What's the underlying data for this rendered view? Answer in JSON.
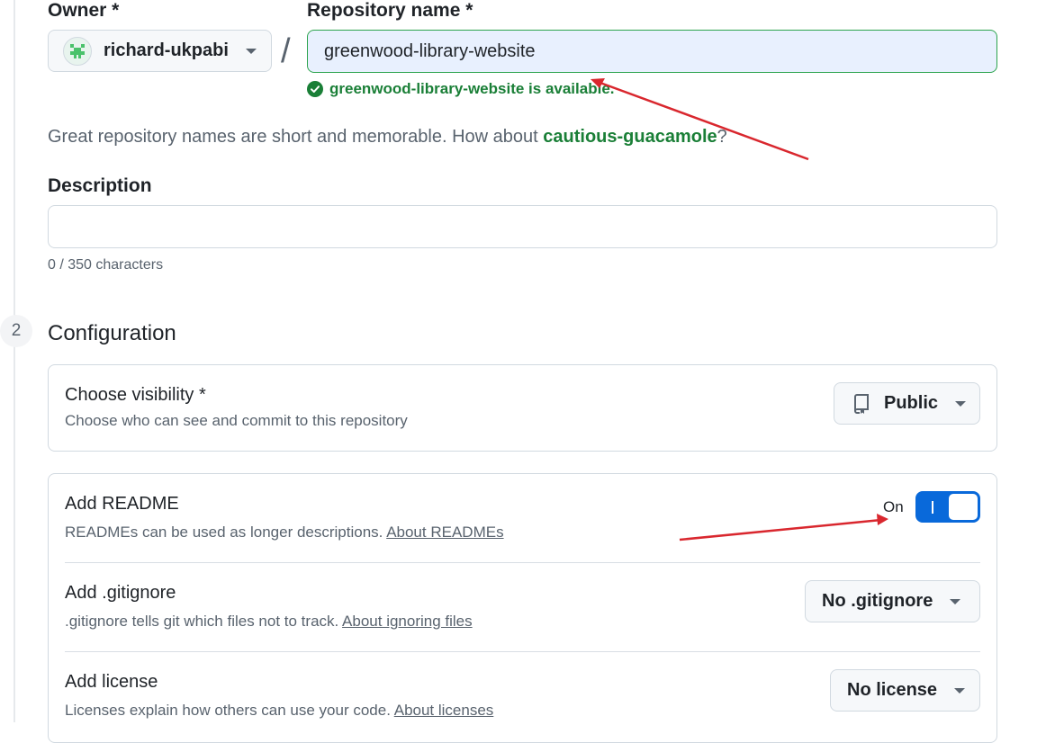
{
  "owner": {
    "label": "Owner *",
    "username": "richard-ukpabi",
    "avatar_icon": "identicon"
  },
  "repository": {
    "label": "Repository name *",
    "value": "greenwood-library-website",
    "availability_message": "greenwood-library-website is available.",
    "hint_prefix": "Great repository names are short and memorable. How about ",
    "hint_suggestion": "cautious-guacamole",
    "hint_suffix": "?"
  },
  "separator": "/",
  "description": {
    "label": "Description",
    "value": "",
    "counter": "0 / 350 characters"
  },
  "configuration": {
    "step_number": "2",
    "title": "Configuration",
    "visibility": {
      "title": "Choose visibility *",
      "subtitle": "Choose who can see and commit to this repository",
      "selected": "Public",
      "icon": "repo-icon"
    },
    "readme": {
      "title": "Add README",
      "subtitle": "READMEs can be used as longer descriptions. ",
      "link": "About READMEs",
      "state_label": "On",
      "enabled": true
    },
    "gitignore": {
      "title": "Add .gitignore",
      "subtitle": ".gitignore tells git which files not to track. ",
      "link": "About ignoring files",
      "selected": "No .gitignore"
    },
    "license": {
      "title": "Add license",
      "subtitle": "Licenses explain how others can use your code. ",
      "link": "About licenses",
      "selected": "No license"
    }
  },
  "colors": {
    "success": "#1a7f37",
    "accent": "#0969da",
    "annotation_arrow": "#d9272e"
  }
}
